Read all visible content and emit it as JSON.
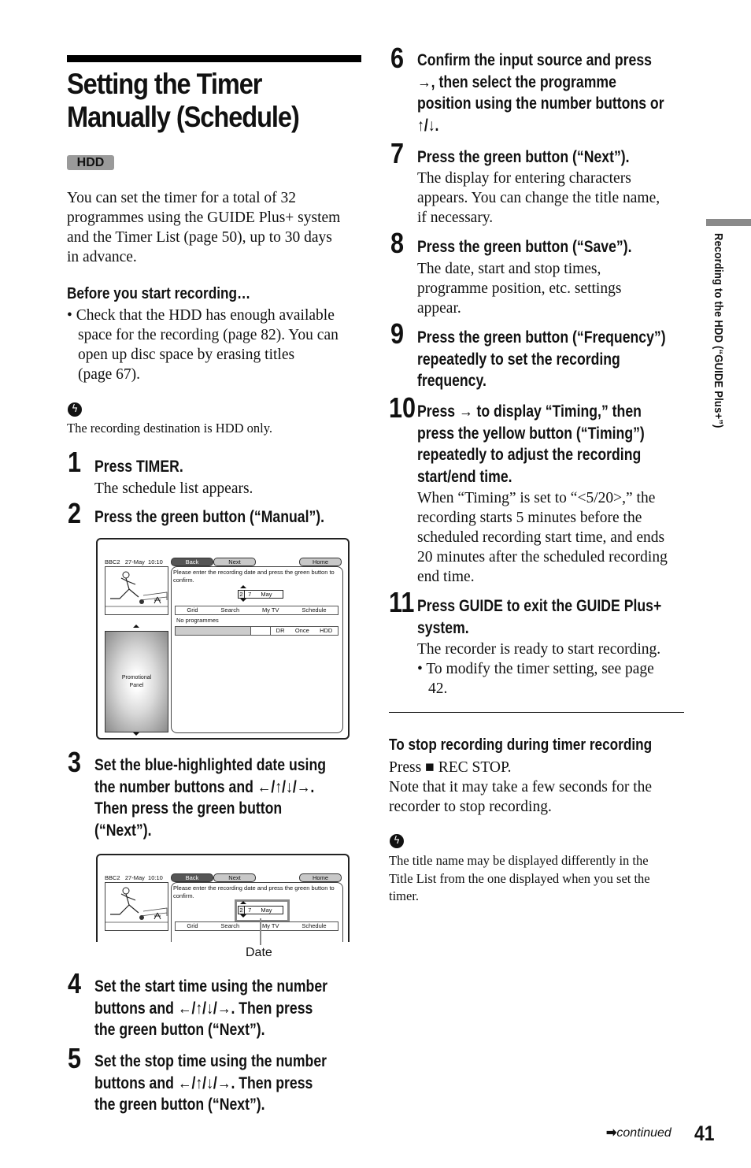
{
  "title": {
    "line1": "Setting the Timer",
    "line2": "Manually (Schedule)",
    "badge": "HDD"
  },
  "intro": {
    "lines": [
      "You can set the timer for a total of 32",
      "programmes using the GUIDE Plus+ system",
      "and the Timer List (page 50), up to 30 days",
      "in advance."
    ]
  },
  "before": {
    "heading": "Before you start recording…",
    "bullet_lines": [
      "• Check that the HDD has enough available",
      "space for the recording (page 82). You can",
      "open up disc space by erasing titles",
      "(page 67)."
    ]
  },
  "tip1": {
    "icon": "tip-icon",
    "text": "The recording destination is HDD only."
  },
  "steps": [
    {
      "num": "1",
      "head": [
        "Press TIMER."
      ],
      "body": [
        "The schedule list appears."
      ]
    },
    {
      "num": "2",
      "head": [
        "Press the green button (“Manual”)."
      ],
      "body": []
    },
    {
      "num": "3",
      "head": [
        "Set the blue-highlighted date using",
        "the number buttons and ←/↑/↓/→.",
        "Then press the green button",
        "(“Next”)."
      ],
      "body": []
    },
    {
      "num": "4",
      "head": [
        "Set the start time using the number",
        "buttons and ←/↑/↓/→. Then press",
        "the green button (“Next”)."
      ],
      "body": []
    },
    {
      "num": "5",
      "head": [
        "Set the stop time using the number",
        "buttons and ←/↑/↓/→. Then press",
        "the green button (“Next”)."
      ],
      "body": []
    },
    {
      "num": "6",
      "head": [
        "Confirm the input source and press",
        "→, then select the programme",
        "position using the number buttons or",
        "↑/↓."
      ],
      "body": []
    },
    {
      "num": "7",
      "head": [
        "Press the green button (“Next”)."
      ],
      "body": [
        "The display for entering characters",
        "appears. You can change the title name,",
        "if necessary."
      ]
    },
    {
      "num": "8",
      "head": [
        "Press the green button (“Save”)."
      ],
      "body": [
        "The date, start and stop times,",
        "programme position, etc. settings",
        "appear."
      ]
    },
    {
      "num": "9",
      "head": [
        "Press the green button (“Frequency”)",
        "repeatedly to set the recording",
        "frequency."
      ],
      "body": []
    },
    {
      "num": "10",
      "head": [
        "Press → to display “Timing,” then",
        "press the yellow button (“Timing”)",
        "repeatedly to adjust the recording",
        "start/end time."
      ],
      "body": [
        "When “Timing” is set to “<5/20>,” the",
        "recording starts 5 minutes before the",
        "scheduled recording start time, and ends",
        "20 minutes after the scheduled recording",
        "end time."
      ]
    },
    {
      "num": "11",
      "head": [
        "Press GUIDE to exit the GUIDE Plus+",
        "system."
      ],
      "body": [
        "The recorder is ready to start recording.",
        "• To modify the timer setting, see page",
        "42."
      ]
    }
  ],
  "screen": {
    "channel": "BBC2",
    "date": "27-May",
    "time": "10:10",
    "back": "Back",
    "next": "Next",
    "home": "Home",
    "prompt_line1": "Please enter the recording date and press the green button to",
    "prompt_line2": "confirm.",
    "date_digit1": "2",
    "date_digit2": "7",
    "date_month": "May",
    "tabs": [
      "Grid",
      "Search",
      "My TV",
      "Schedule"
    ],
    "no_programmes": "No programmes",
    "rec_mode": "DR",
    "frequency": "Once",
    "destination": "HDD",
    "promo_line1": "Promotional",
    "promo_line2": "Panel",
    "callout": "Date"
  },
  "stop_section": {
    "heading": "To stop recording during timer recording",
    "line1_prefix": "Press",
    "stop_symbol": "■",
    "line1_suffix": "REC STOP.",
    "lines": [
      "Note that it may take a few seconds for the",
      "recorder to stop recording."
    ]
  },
  "tip2": {
    "icon": "tip-icon",
    "lines": [
      "The title name may be displayed differently in the",
      "Title List from the one displayed when you set the",
      "timer."
    ]
  },
  "side_tab": "Recording to the HDD (“GUIDE Plus+”)",
  "footer": {
    "continued": "continued",
    "page_number": "41"
  }
}
